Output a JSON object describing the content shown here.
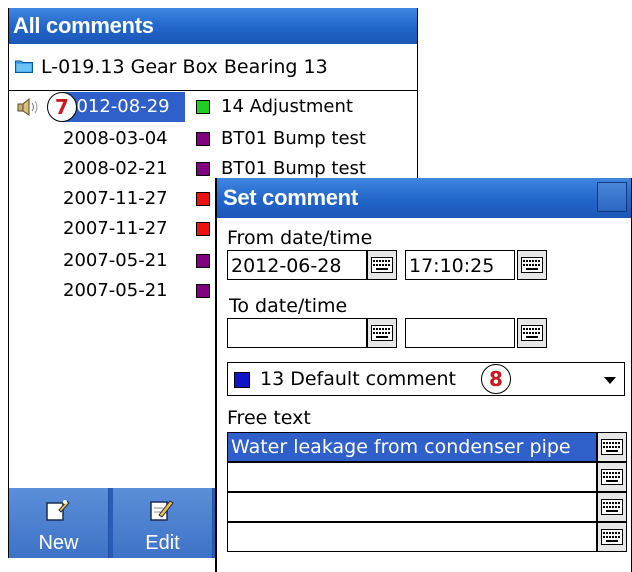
{
  "all_comments": {
    "title": "All comments",
    "path": "L-019.13 Gear Box Bearing 13",
    "badge_7": "7",
    "rows": [
      {
        "date": "2012-08-29",
        "color": "#22cc22",
        "text": "14 Adjustment"
      },
      {
        "date": "2008-03-04",
        "color": "#800080",
        "text": "BT01 Bump test"
      },
      {
        "date": "2008-02-21",
        "color": "#800080",
        "text": "BT01 Bump test"
      },
      {
        "date": "2007-11-27",
        "color": "#ee1111",
        "text": ""
      },
      {
        "date": "2007-11-27",
        "color": "#ee1111",
        "text": ""
      },
      {
        "date": "2007-05-21",
        "color": "#800080",
        "text": ""
      },
      {
        "date": "2007-05-21",
        "color": "#800080",
        "text": ""
      }
    ],
    "buttons": {
      "new": "New",
      "edit": "Edit"
    }
  },
  "set_comment": {
    "title": "Set comment",
    "from_label": "From date/time",
    "from_date": "2012-06-28",
    "from_time": "17:10:25",
    "to_label": "To date/time",
    "to_date": "",
    "to_time": "",
    "comment_type": {
      "color": "#1212c8",
      "text": "13  Default comment"
    },
    "badge_8": "8",
    "free_text_label": "Free text",
    "free_text_lines": [
      "Water leakage from condenser pipe",
      "",
      "",
      ""
    ]
  },
  "colors": {
    "titlebar": "#2165c8",
    "selection": "#2f5fc9",
    "badge_text": "#c9181f"
  },
  "icons": [
    "folder-icon",
    "speaker-icon",
    "keyboard-icon",
    "new-note-icon",
    "edit-note-icon",
    "dropdown-arrow-icon"
  ]
}
